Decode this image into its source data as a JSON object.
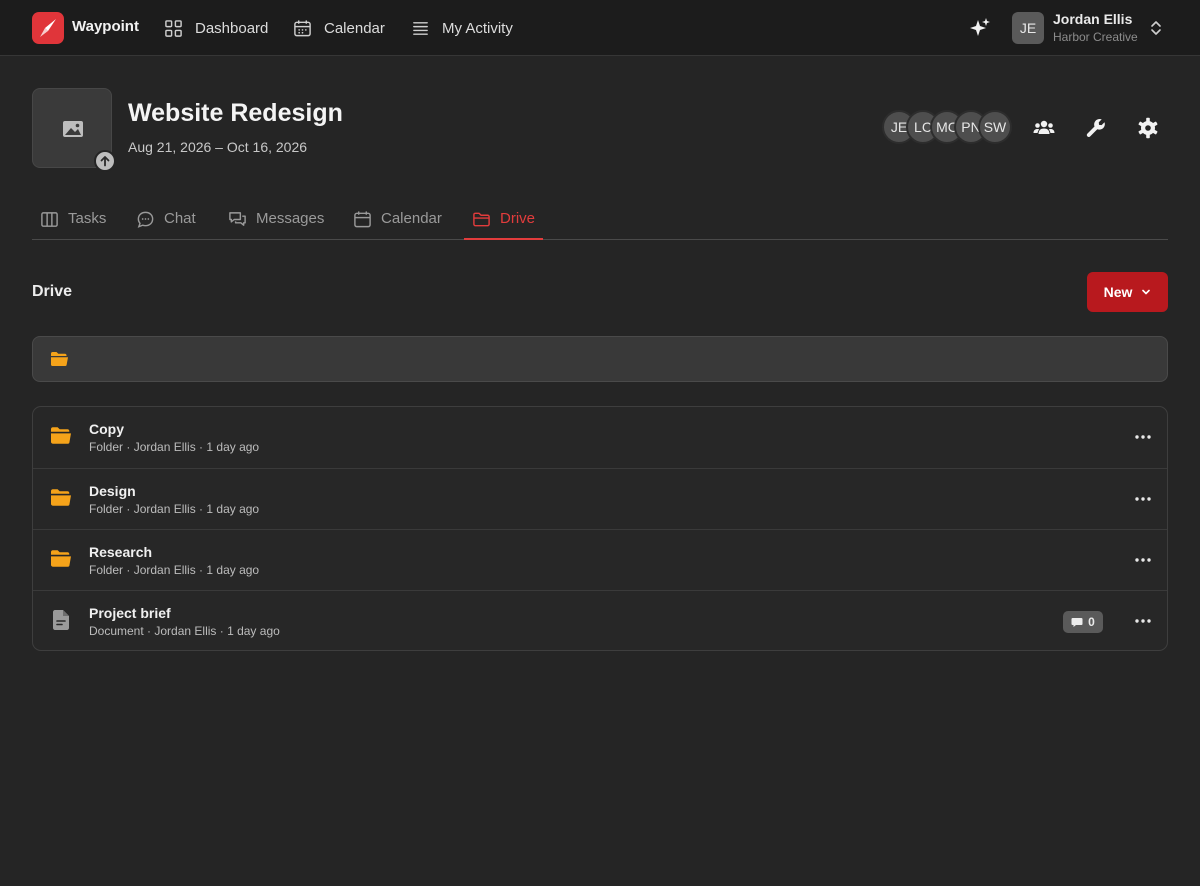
{
  "app": {
    "name": "Waypoint",
    "accent": "#e0353a"
  },
  "nav": {
    "items": [
      {
        "label": "Dashboard",
        "icon": "grid-icon"
      },
      {
        "label": "Calendar",
        "icon": "calendar-icon"
      },
      {
        "label": "My Activity",
        "icon": "list-icon"
      }
    ]
  },
  "user": {
    "initials": "JE",
    "name": "Jordan Ellis",
    "org": "Harbor Creative"
  },
  "project": {
    "title": "Website Redesign",
    "dates": "Aug 21, 2026 – Oct 16, 2026",
    "members": [
      "JE",
      "LC",
      "MC",
      "PN",
      "SW"
    ]
  },
  "tabs": [
    {
      "label": "Tasks",
      "icon": "columns-icon"
    },
    {
      "label": "Chat",
      "icon": "chat-bubble-icon"
    },
    {
      "label": "Messages",
      "icon": "messages-icon"
    },
    {
      "label": "Calendar",
      "icon": "calendar-icon"
    },
    {
      "label": "Drive",
      "icon": "folder-icon",
      "active": true
    }
  ],
  "drive": {
    "title": "Drive",
    "new_label": "New",
    "items": [
      {
        "name": "Copy",
        "type": "Folder",
        "owner": "Jordan Ellis",
        "modified": "1 day ago",
        "icon": "folder-icon"
      },
      {
        "name": "Design",
        "type": "Folder",
        "owner": "Jordan Ellis",
        "modified": "1 day ago",
        "icon": "folder-icon"
      },
      {
        "name": "Research",
        "type": "Folder",
        "owner": "Jordan Ellis",
        "modified": "1 day ago",
        "icon": "folder-icon"
      },
      {
        "name": "Project brief",
        "type": "Document",
        "owner": "Jordan Ellis",
        "modified": "1 day ago",
        "icon": "document-icon",
        "comments": "0"
      }
    ]
  },
  "colors": {
    "folder": "#f5a31a",
    "new_button": "#b8191e",
    "active_tab": "#e23c3c"
  }
}
